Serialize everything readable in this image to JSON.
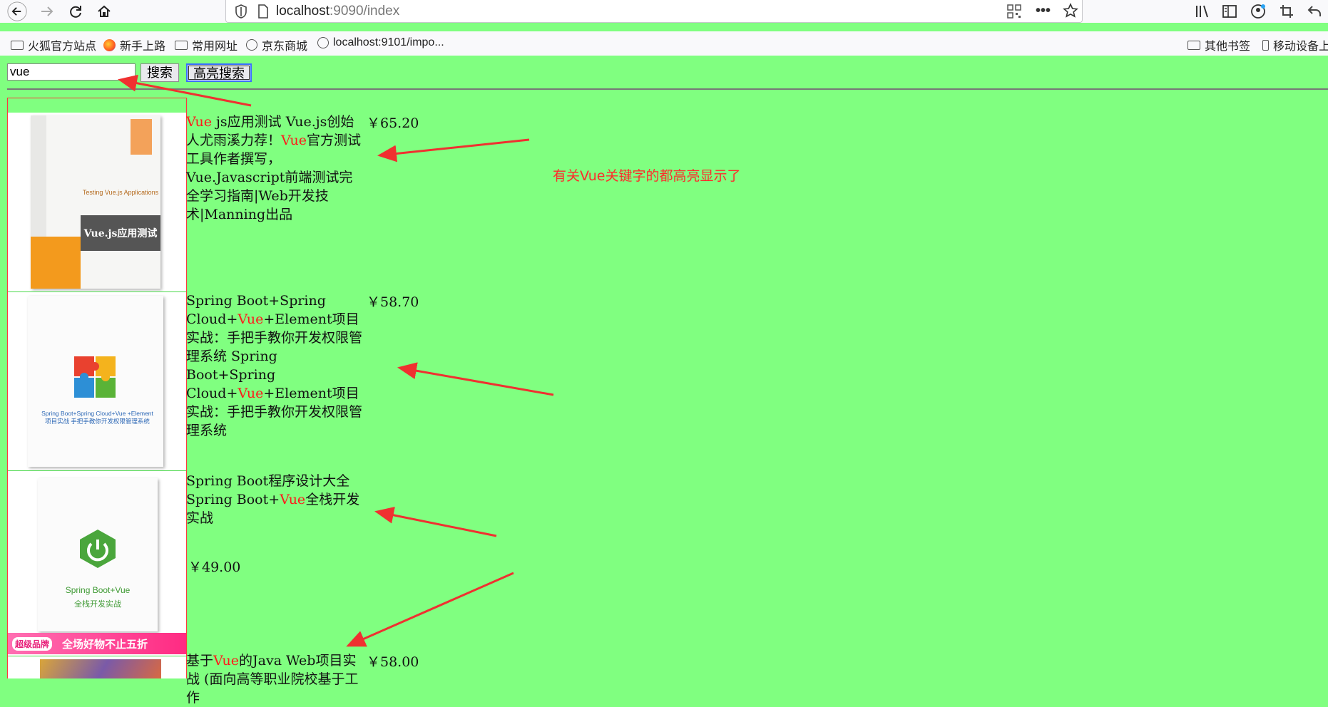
{
  "browser": {
    "url_host": "localhost",
    "url_rest": ":9090/index",
    "bookmarks": [
      "火狐官方站点",
      "新手上路",
      "常用网址",
      "京东商城",
      "localhost:9101/impo..."
    ],
    "bookmarks_right": [
      "其他书签",
      "移动设备上"
    ]
  },
  "search": {
    "value": "vue",
    "search_label": "搜索",
    "highlight_label": "高亮搜索"
  },
  "results": [
    {
      "title_parts": [
        [
          "Vue",
          true
        ],
        [
          " js应用测试 Vue.js创始人尤雨溪力荐！",
          false
        ],
        [
          "Vue",
          true
        ],
        [
          "官方测试工具作者撰写，Vue.Javascript前端测试完全学习指南|Web开发技术|Manning出品",
          false
        ]
      ],
      "price": "￥65.20",
      "cover_title_cn": "Vue.js应用测试",
      "cover_title_en": "Testing Vue.js Applications"
    },
    {
      "title_parts": [
        [
          "Spring Boot+Spring Cloud+",
          false
        ],
        [
          "Vue",
          true
        ],
        [
          "+Element项目实战：手把手教你开发权限管理系统 Spring Boot+Spring Cloud+",
          false
        ],
        [
          "Vue",
          true
        ],
        [
          "+Element项目实战：手把手教你开发权限管理系统",
          false
        ]
      ],
      "price": "￥58.70",
      "cover_caption": "Spring Boot+Spring Cloud+Vue +Element项目实战 手把手教你开发权限管理系统"
    },
    {
      "title_parts": [
        [
          "Spring Boot程序设计大全 Spring Boot+",
          false
        ],
        [
          "Vue",
          true
        ],
        [
          "全栈开发实战",
          false
        ]
      ],
      "price": "￥49.00",
      "cover_caption_1": "Spring Boot+Vue",
      "cover_caption_2": "全栈开发实战",
      "banner_logo": "超级品牌",
      "banner_text": "全场好物不止五折"
    },
    {
      "title_parts": [
        [
          "基于",
          false
        ],
        [
          "Vue",
          true
        ],
        [
          "的Java Web项目实战 (面向高等职业院校基于工作",
          false
        ]
      ],
      "price": "￥58.00"
    }
  ],
  "annotation": "有关Vue关键字的都高亮显示了",
  "colors": {
    "highlight": "#ff1a1a",
    "page_bg": "#80ff80",
    "arrow": "#f03030"
  }
}
